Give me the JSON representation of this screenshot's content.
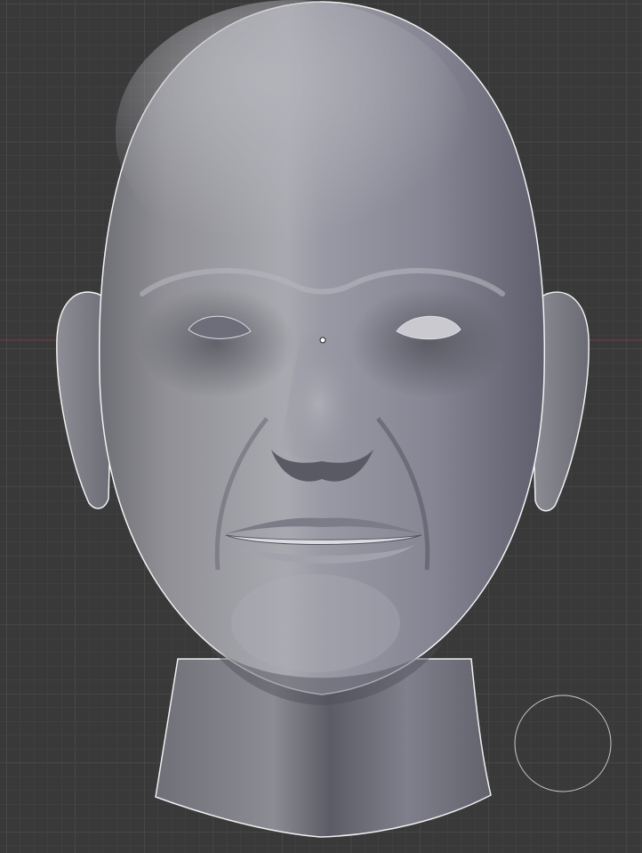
{
  "viewport": {
    "view": "front-orthographic",
    "background_color": "#393939",
    "grid": {
      "visible": true,
      "minor_color": "#444444",
      "major_color": "#4f4f4f"
    },
    "x_axis_color": "#8a3a3a"
  },
  "model": {
    "object": "sculpted-head-mesh",
    "material_color": "#9a9aa8",
    "selection_outline_color": "#f2f2f2"
  },
  "overlays": {
    "origin_point": "object-origin-dot-icon",
    "brush_cursor": "sculpt-brush-circle-icon"
  }
}
